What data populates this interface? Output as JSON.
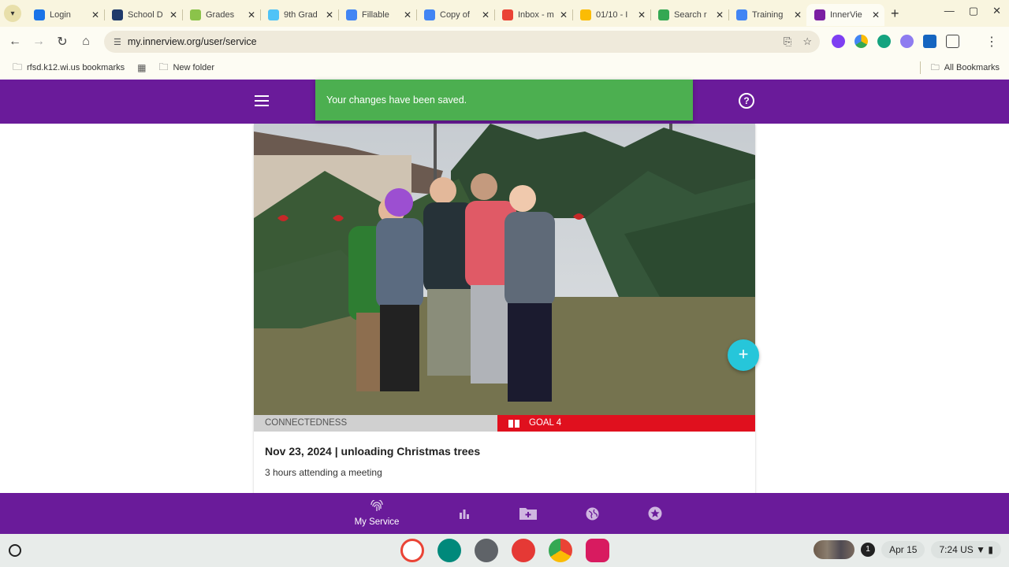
{
  "browser": {
    "tabs": [
      {
        "label": "Login",
        "color": "#1a73e8"
      },
      {
        "label": "School D",
        "color": "#1f3a6b"
      },
      {
        "label": "Grades",
        "color": "#8bc34a"
      },
      {
        "label": "9th Grad",
        "color": "#4fc3f7"
      },
      {
        "label": "Fillable",
        "color": "#4285f4"
      },
      {
        "label": "Copy of",
        "color": "#4285f4"
      },
      {
        "label": "Inbox - m",
        "color": "#ea4335"
      },
      {
        "label": "01/10 - I",
        "color": "#fbbc04"
      },
      {
        "label": "Search r",
        "color": "#34a853"
      },
      {
        "label": "Training",
        "color": "#4285f4"
      },
      {
        "label": "InnerVie",
        "color": "#7b1fa2",
        "active": true
      }
    ],
    "url": "my.innerview.org/user/service",
    "bookmarks": [
      {
        "label": "rfsd.k12.wi.us bookmarks"
      },
      {
        "label": "New folder"
      }
    ],
    "all_bookmarks": "All Bookmarks"
  },
  "app": {
    "accent": "#6a1b9a",
    "snackbar": "Your changes have been saved.",
    "entry": {
      "category": "CONNECTEDNESS",
      "goal": "GOAL 4",
      "title": "Nov 23, 2024 | unloading Christmas trees",
      "subtitle": "3 hours attending a meeting"
    },
    "bottom_nav": {
      "my_service": "My Service"
    }
  },
  "shelf": {
    "date": "Apr 15",
    "time": "7:24",
    "locale": "US",
    "notification_count": "1"
  }
}
